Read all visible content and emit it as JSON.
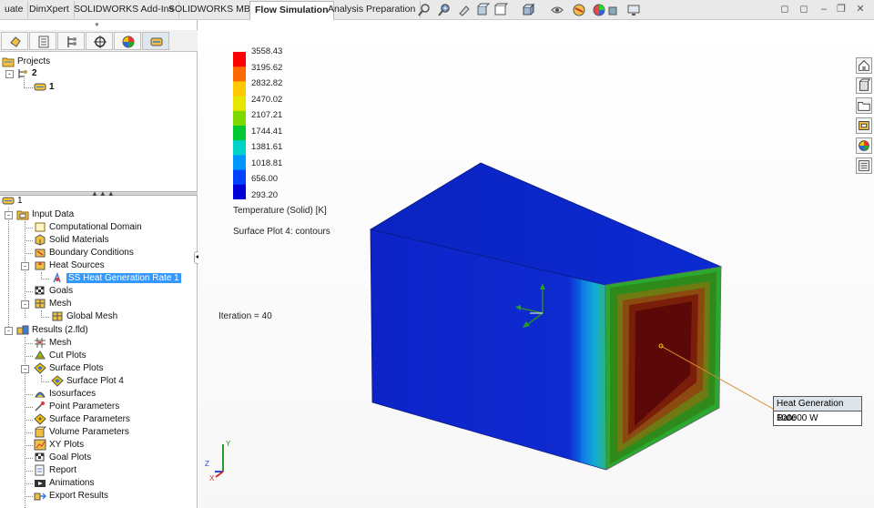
{
  "top_tabs": [
    {
      "label": "uate"
    },
    {
      "label": "DimXpert"
    },
    {
      "label": "SOLIDWORKS Add-Ins"
    },
    {
      "label": "SOLIDWORKS MBD"
    },
    {
      "label": "Flow Simulation",
      "active": true
    },
    {
      "label": "Analysis Preparation"
    }
  ],
  "projects_tree": {
    "root": "Projects",
    "project": "2",
    "config": "1"
  },
  "analysis_tree": {
    "root": "1",
    "input_data": "Input Data",
    "computational_domain": "Computational Domain",
    "solid_materials": "Solid Materials",
    "boundary_conditions": "Boundary Conditions",
    "heat_sources": "Heat Sources",
    "heat_source_item": "SS Heat Generation Rate 1",
    "goals": "Goals",
    "mesh": "Mesh",
    "global_mesh": "Global Mesh",
    "results": "Results (2.fld)",
    "results_mesh": "Mesh",
    "cut_plots": "Cut Plots",
    "surface_plots": "Surface Plots",
    "surface_plot_4": "Surface Plot 4",
    "isosurfaces": "Isosurfaces",
    "point_parameters": "Point Parameters",
    "surface_parameters": "Surface Parameters",
    "volume_parameters": "Volume Parameters",
    "xy_plots": "XY Plots",
    "goal_plots": "Goal Plots",
    "report": "Report",
    "animations": "Animations",
    "export_results": "Export Results"
  },
  "legend": {
    "values": [
      "3558.43",
      "3195.62",
      "2832.82",
      "2470.02",
      "2107.21",
      "1744.41",
      "1381.61",
      "1018.81",
      "656.00",
      "293.20"
    ],
    "colors": [
      "#ff0000",
      "#ff6a00",
      "#ffc800",
      "#e6e600",
      "#7dd800",
      "#00c832",
      "#00d2c8",
      "#0096ff",
      "#0040ff",
      "#0000d8"
    ],
    "quantity": "Temperature (Solid) [K]",
    "plot_name": "Surface Plot 4: contours"
  },
  "iteration_text": "Iteration = 40",
  "callout": {
    "title": "Heat Generation Rate",
    "value": "100000 W"
  },
  "axis_triad": {
    "x": "X",
    "y": "Y",
    "z": "Z"
  }
}
